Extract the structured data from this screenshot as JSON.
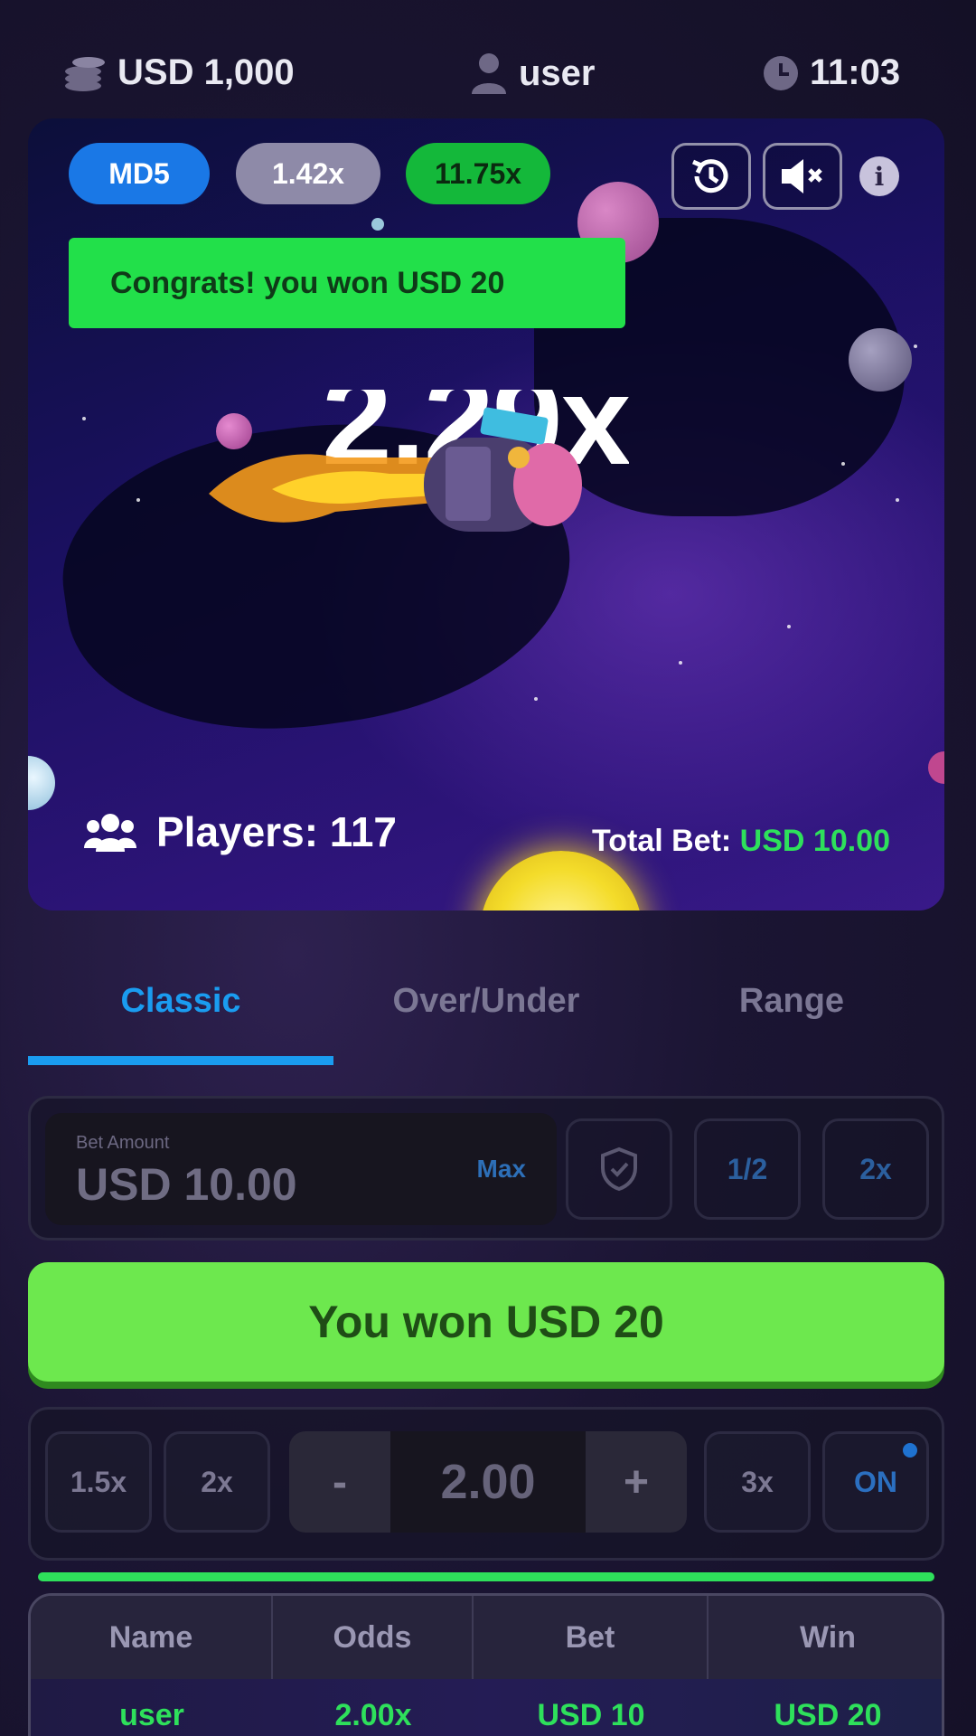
{
  "topbar": {
    "balance": "USD 1,000",
    "username": "user",
    "time": "11:03"
  },
  "game": {
    "pills": {
      "md5": "MD5",
      "prev_1": "1.42x",
      "prev_2": "11.75x"
    },
    "multiplier": "2.29x",
    "toast": "Congrats! you won USD 20",
    "players_label": "Players:",
    "players_count": "117",
    "total_bet_label": "Total Bet:",
    "total_bet_value": "USD 10.00",
    "icons": [
      "history-icon",
      "mute-icon",
      "info-icon"
    ]
  },
  "tabs": [
    "Classic",
    "Over/Under",
    "Range"
  ],
  "active_tab": "Classic",
  "bet": {
    "label": "Bet Amount",
    "value": "USD 10.00",
    "max_label": "Max",
    "half_label": "1/2",
    "double_label": "2x"
  },
  "won_button": "You won USD 20",
  "auto_cashout": {
    "preset_1": "1.5x",
    "preset_2": "2x",
    "minus": "-",
    "value": "2.00",
    "plus": "+",
    "preset_3": "3x",
    "toggle": "ON"
  },
  "progress_fraction": 1.0,
  "table": {
    "headers": [
      "Name",
      "Odds",
      "Bet",
      "Win"
    ],
    "rows": [
      [
        "user",
        "2.00x",
        "USD 10",
        "USD 20"
      ]
    ]
  },
  "colors": {
    "accent_blue": "#1a9cf0",
    "win_green": "#2ee05b",
    "button_green": "#6de84e",
    "toast_green": "#22e04a"
  }
}
